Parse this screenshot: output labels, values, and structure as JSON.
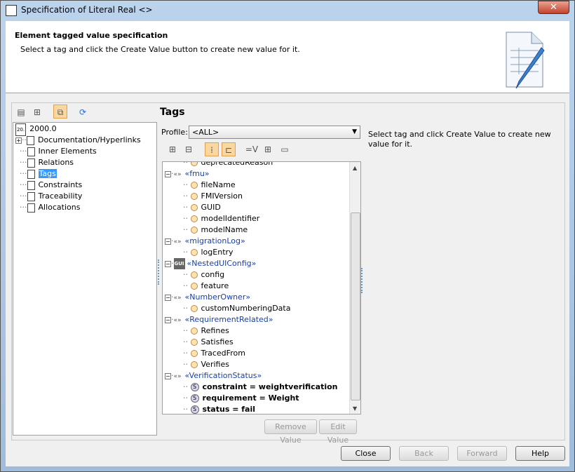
{
  "window": {
    "title": "Specification of Literal Real <>",
    "close": "✕"
  },
  "header": {
    "title": "Element tagged value specification",
    "subtitle": "Select a tag and click the Create Value button to create new value for it."
  },
  "left_tree": {
    "root": "2000.0",
    "items": [
      "Documentation/Hyperlinks",
      "Inner Elements",
      "Relations",
      "Tags",
      "Constraints",
      "Traceability",
      "Allocations"
    ],
    "selected": "Tags"
  },
  "tags_panel": {
    "title": "Tags",
    "profile_label": "Profile:",
    "profile_value": "<ALL>",
    "rows": [
      {
        "level": 2,
        "kind": "prop",
        "text": "deprecatedReason"
      },
      {
        "level": 1,
        "kind": "stereo",
        "text": "«fmu»"
      },
      {
        "level": 2,
        "kind": "prop",
        "text": "fileName"
      },
      {
        "level": 2,
        "kind": "prop",
        "text": "FMIVersion"
      },
      {
        "level": 2,
        "kind": "prop",
        "text": "GUID"
      },
      {
        "level": 2,
        "kind": "prop",
        "text": "modelIdentifier"
      },
      {
        "level": 2,
        "kind": "prop",
        "text": "modelName"
      },
      {
        "level": 1,
        "kind": "stereo",
        "text": "«migrationLog»"
      },
      {
        "level": 2,
        "kind": "prop",
        "text": "logEntry"
      },
      {
        "level": 1,
        "kind": "gui",
        "text": "«NestedUIConfig»"
      },
      {
        "level": 2,
        "kind": "prop",
        "text": "config"
      },
      {
        "level": 2,
        "kind": "prop",
        "text": "feature"
      },
      {
        "level": 1,
        "kind": "stereo",
        "text": "«NumberOwner»"
      },
      {
        "level": 2,
        "kind": "prop",
        "text": "customNumberingData"
      },
      {
        "level": 1,
        "kind": "stereo",
        "text": "«RequirementRelated»"
      },
      {
        "level": 2,
        "kind": "prop",
        "text": "Refines"
      },
      {
        "level": 2,
        "kind": "prop",
        "text": "Satisfies"
      },
      {
        "level": 2,
        "kind": "prop",
        "text": "TracedFrom"
      },
      {
        "level": 2,
        "kind": "prop",
        "text": "Verifies"
      },
      {
        "level": 1,
        "kind": "stereo",
        "text": "«VerificationStatus»"
      },
      {
        "level": 2,
        "kind": "value",
        "text": "constraint = weightverification"
      },
      {
        "level": 2,
        "kind": "value",
        "text": "requirement = Weight"
      },
      {
        "level": 2,
        "kind": "value",
        "text": "status = fail"
      }
    ],
    "remove_value": "Remove Value",
    "edit_value": "Edit Value",
    "hint": "Select tag and click Create Value to create new value for it."
  },
  "footer": {
    "close": "Close",
    "back": "Back",
    "forward": "Forward",
    "help": "Help"
  }
}
